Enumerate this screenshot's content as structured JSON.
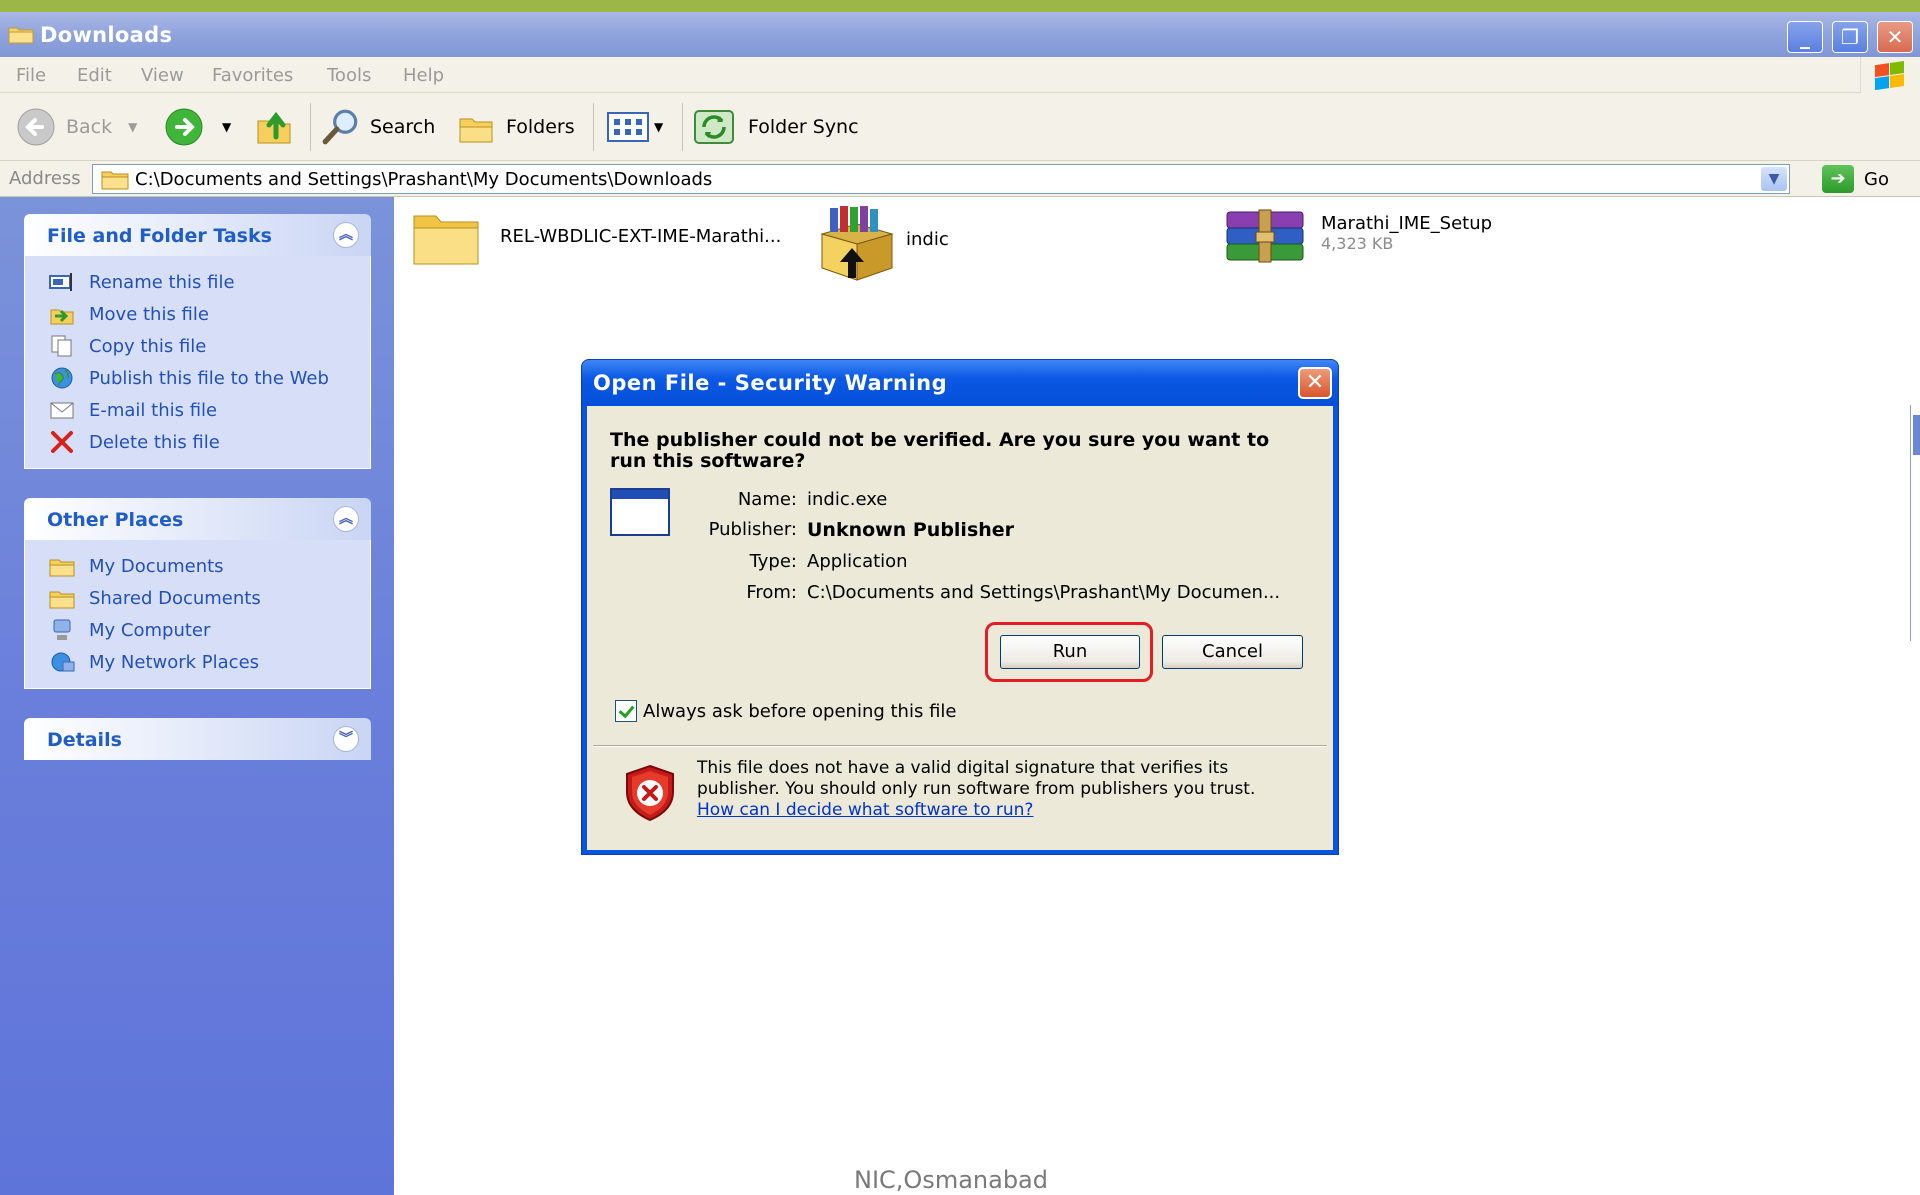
{
  "window": {
    "title": "Downloads",
    "controls": {
      "minimize": "_",
      "restore": "❐",
      "close": "✕"
    }
  },
  "menubar": {
    "items": [
      {
        "label": "File"
      },
      {
        "label": "Edit"
      },
      {
        "label": "View"
      },
      {
        "label": "Favorites"
      },
      {
        "label": "Tools"
      },
      {
        "label": "Help"
      }
    ]
  },
  "toolbar": {
    "back_label": "Back",
    "search_label": "Search",
    "folders_label": "Folders",
    "folder_sync_label": "Folder Sync"
  },
  "address": {
    "label": "Address",
    "value": "C:\\Documents and Settings\\Prashant\\My Documents\\Downloads",
    "go_label": "Go"
  },
  "left_pane": {
    "file_tasks": {
      "header": "File and Folder Tasks",
      "items": [
        {
          "label": "Rename this file",
          "icon": "rename-icon"
        },
        {
          "label": "Move this file",
          "icon": "move-icon"
        },
        {
          "label": "Copy this file",
          "icon": "copy-icon"
        },
        {
          "label": "Publish this file to the Web",
          "icon": "globe-icon"
        },
        {
          "label": "E-mail this file",
          "icon": "email-icon"
        },
        {
          "label": "Delete this file",
          "icon": "delete-icon"
        }
      ]
    },
    "other_places": {
      "header": "Other Places",
      "items": [
        {
          "label": "My Documents",
          "icon": "folder-icon"
        },
        {
          "label": "Shared Documents",
          "icon": "folder-icon"
        },
        {
          "label": "My Computer",
          "icon": "computer-icon"
        },
        {
          "label": "My Network Places",
          "icon": "network-icon"
        }
      ]
    },
    "details": {
      "header": "Details"
    }
  },
  "files": [
    {
      "name": "REL-WBDLIC-EXT-IME-Marathi...",
      "icon": "folder-icon"
    },
    {
      "name": "indic",
      "icon": "installer-icon"
    },
    {
      "name": "Marathi_IME_Setup",
      "size": "4,323 KB",
      "icon": "winrar-archive-icon"
    }
  ],
  "dialog": {
    "title": "Open File - Security Warning",
    "heading": "The publisher could not be verified.  Are you sure you want to run this software?",
    "fields": {
      "name_label": "Name:",
      "name_value": "indic.exe",
      "publisher_label": "Publisher:",
      "publisher_value": "Unknown Publisher",
      "type_label": "Type:",
      "type_value": "Application",
      "from_label": "From:",
      "from_value": "C:\\Documents and Settings\\Prashant\\My Documen..."
    },
    "run_label": "Run",
    "cancel_label": "Cancel",
    "always_ask_label": "Always ask before opening this file",
    "always_ask_checked": true,
    "warning_text": "This file does not have a valid digital signature that verifies its publisher.  You should only run software from publishers you trust.",
    "help_link": "How can I decide what software to run?"
  },
  "footer": {
    "text": "NIC,Osmanabad"
  },
  "colors": {
    "top_strip": "#9cb648",
    "left_pane": "#6a7fdb",
    "dialog_title": "#0a58e4",
    "highlight": "#e31e24",
    "link": "#2350b8"
  }
}
